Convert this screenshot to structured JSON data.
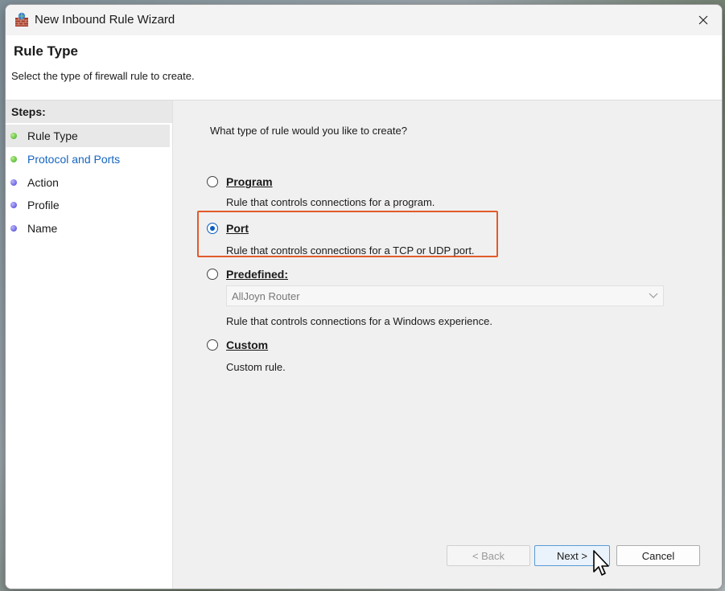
{
  "window": {
    "title": "New Inbound Rule Wizard"
  },
  "header": {
    "title": "Rule Type",
    "subtitle": "Select the type of firewall rule to create."
  },
  "steps": {
    "title": "Steps:",
    "items": [
      {
        "label": "Rule Type",
        "status": "done"
      },
      {
        "label": "Protocol and Ports",
        "status": "done"
      },
      {
        "label": "Action",
        "status": "pending"
      },
      {
        "label": "Profile",
        "status": "pending"
      },
      {
        "label": "Name",
        "status": "pending"
      }
    ]
  },
  "content": {
    "question": "What type of rule would you like to create?",
    "options": [
      {
        "label": "Program",
        "description": "Rule that controls connections for a program.",
        "checked": false
      },
      {
        "label": "Port",
        "description": "Rule that controls connections for a TCP or UDP port.",
        "checked": true
      },
      {
        "label": "Predefined:",
        "description": "Rule that controls connections for a Windows experience.",
        "checked": false
      },
      {
        "label": "Custom",
        "description": "Custom rule.",
        "checked": false
      }
    ],
    "predefined_select": {
      "value": "AllJoyn Router"
    }
  },
  "buttons": {
    "back": "< Back",
    "next": "Next >",
    "cancel": "Cancel"
  },
  "colors": {
    "accent": "#0a5dc2",
    "highlight": "#e25a2a",
    "link": "#1565c0"
  }
}
